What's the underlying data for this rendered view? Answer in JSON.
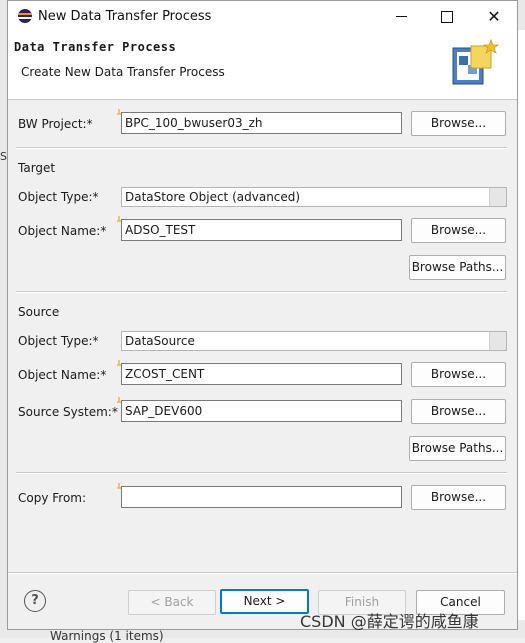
{
  "window": {
    "title": "New Data Transfer Process"
  },
  "header": {
    "title": "Data Transfer Process",
    "subtitle": "Create New Data Transfer Process"
  },
  "bw_project": {
    "label": "BW Project:*",
    "value": "BPC_100_bwuser03_zh",
    "browse_label": "Browse..."
  },
  "target": {
    "section_label": "Target",
    "object_type_label": "Object Type:*",
    "object_type_value": "DataStore Object (advanced)",
    "object_name_label": "Object Name:*",
    "object_name_value": "ADSO_TEST",
    "browse_label": "Browse...",
    "browse_paths_label": "Browse Paths..."
  },
  "source": {
    "section_label": "Source",
    "object_type_label": "Object Type:*",
    "object_type_value": "DataSource",
    "object_name_label": "Object Name:*",
    "object_name_value": "ZCOST_CENT",
    "object_name_browse_label": "Browse...",
    "source_system_label": "Source System:*",
    "source_system_value": "SAP_DEV600",
    "source_system_browse_label": "Browse...",
    "browse_paths_label": "Browse Paths..."
  },
  "copy_from": {
    "label": "Copy From:",
    "value": "",
    "browse_label": "Browse..."
  },
  "footer": {
    "help_symbol": "?",
    "back_label": "< Back",
    "next_label": "Next >",
    "finish_label": "Finish",
    "cancel_label": "Cancel"
  },
  "background": {
    "edge_text": "ST",
    "bottom_text": "Warnings (1 items)"
  },
  "watermark": "CSDN @薛定谔的咸鱼康",
  "colors": {
    "required_marker": "#f2b544",
    "default_button_border": "#0078d7",
    "disabled_text": "#a0a0a0"
  }
}
